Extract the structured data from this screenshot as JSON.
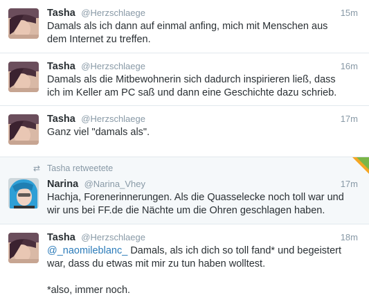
{
  "tweets": [
    {
      "name": "Tasha",
      "handle": "@Herzschlaege",
      "time": "15m",
      "text": "Damals als ich dann auf einmal anfing, mich mit Menschen aus\ndem Internet zu treffen."
    },
    {
      "name": "Tasha",
      "handle": "@Herzschlaege",
      "time": "16m",
      "text": "Damals als die Mitbewohnerin sich dadurch inspirieren ließ, dass\nich im Keller am PC saß und dann eine Geschichte dazu schrieb."
    },
    {
      "name": "Tasha",
      "handle": "@Herzschlaege",
      "time": "17m",
      "text": "Ganz viel \"damals als\"."
    },
    {
      "retweeted_by": "Tasha retweetete",
      "name": "Narina",
      "handle": "@Narina_Vhey",
      "time": "17m",
      "text": "Hachja, Forenerinnerungen. Als die Quasselecke noch toll war und\nwir uns bei FF.de die Nächte um die Ohren geschlagen haben."
    },
    {
      "name": "Tasha",
      "handle": "@Herzschlaege",
      "time": "18m",
      "mention": "@_naomileblanc_",
      "text": " Damals, als ich dich so toll fand* und begeistert\nwar, dass du etwas mit mir zu tun haben wolltest.\n\n*also, immer noch."
    }
  ],
  "icons": {
    "retweet": "retweet-icon",
    "corner": "favorite-corner-icon"
  }
}
